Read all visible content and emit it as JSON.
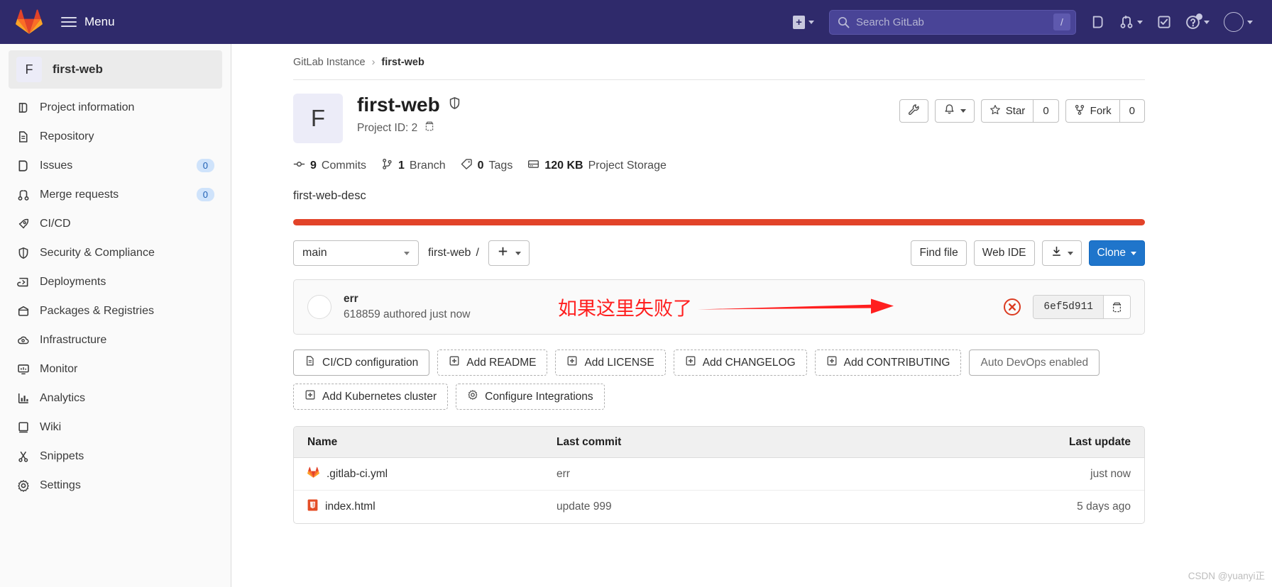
{
  "topnav": {
    "brand_icon": "gitlab-logo-icon",
    "menu_label": "Menu",
    "create_icon": "plus-square-icon",
    "search_placeholder": "Search GitLab",
    "search_value": "",
    "search_shortcut": "/",
    "issues_icon": "issues-icon",
    "merge_requests_icon": "merge-request-icon",
    "todos_icon": "todo-checkbox-icon",
    "help_icon": "question-circle-icon",
    "avatar_icon": "user-avatar-icon"
  },
  "sidebar": {
    "project_initial": "F",
    "project_name": "first-web",
    "items": [
      {
        "label": "Project information",
        "icon": "project-info-icon",
        "badge": ""
      },
      {
        "label": "Repository",
        "icon": "repository-doc-icon",
        "badge": ""
      },
      {
        "label": "Issues",
        "icon": "issues-icon",
        "badge": "0"
      },
      {
        "label": "Merge requests",
        "icon": "merge-request-icon",
        "badge": "0"
      },
      {
        "label": "CI/CD",
        "icon": "rocket-icon",
        "badge": ""
      },
      {
        "label": "Security & Compliance",
        "icon": "shield-icon",
        "badge": ""
      },
      {
        "label": "Deployments",
        "icon": "deployments-icon",
        "badge": ""
      },
      {
        "label": "Packages & Registries",
        "icon": "package-icon",
        "badge": ""
      },
      {
        "label": "Infrastructure",
        "icon": "cloud-gear-icon",
        "badge": ""
      },
      {
        "label": "Monitor",
        "icon": "monitor-icon",
        "badge": ""
      },
      {
        "label": "Analytics",
        "icon": "chart-bar-icon",
        "badge": ""
      },
      {
        "label": "Wiki",
        "icon": "book-icon",
        "badge": ""
      },
      {
        "label": "Snippets",
        "icon": "scissors-icon",
        "badge": ""
      },
      {
        "label": "Settings",
        "icon": "gear-icon",
        "badge": ""
      }
    ]
  },
  "breadcrumb": {
    "root": "GitLab Instance",
    "separator": "›",
    "current": "first-web"
  },
  "project": {
    "initial": "F",
    "title": "first-web",
    "visibility_icon": "shield-private-icon",
    "project_id_label": "Project ID: 2",
    "copy_icon": "copy-clipboard-icon",
    "description": "first-web-desc",
    "language_bar_color": "#e24329",
    "actions": {
      "settings_icon": "wrench-icon",
      "notifications_icon": "bell-icon",
      "star_label": "Star",
      "star_count": "0",
      "star_icon": "star-icon",
      "fork_label": "Fork",
      "fork_count": "0",
      "fork_icon": "fork-icon"
    },
    "stats": [
      {
        "icon": "commit-icon",
        "value": "9",
        "label": "Commits"
      },
      {
        "icon": "branch-icon",
        "value": "1",
        "label": "Branch"
      },
      {
        "icon": "tag-icon",
        "value": "0",
        "label": "Tags"
      },
      {
        "icon": "storage-icon",
        "value": "120 KB",
        "label": "Project Storage"
      }
    ]
  },
  "toolbar": {
    "branch": "main",
    "path_root": "first-web",
    "path_separator": "/",
    "add_icon": "plus-icon",
    "find_file_label": "Find file",
    "web_ide_label": "Web IDE",
    "download_icon": "download-icon",
    "clone_label": "Clone"
  },
  "last_commit": {
    "message": "err",
    "author_line": "618859 authored just now",
    "pipeline_status_icon": "pipeline-failed-icon",
    "sha": "6ef5d911",
    "copy_icon": "copy-clipboard-icon"
  },
  "annotation": {
    "text": "如果这里失败了",
    "color": "#ff1f1f",
    "arrow_icon": "red-arrow-right-icon"
  },
  "quick_actions": [
    {
      "label": "CI/CD configuration",
      "icon": "file-doc-icon",
      "style": "solid"
    },
    {
      "label": "Add README",
      "icon": "plus-box-icon",
      "style": "dashed"
    },
    {
      "label": "Add LICENSE",
      "icon": "plus-box-icon",
      "style": "dashed"
    },
    {
      "label": "Add CHANGELOG",
      "icon": "plus-box-icon",
      "style": "dashed"
    },
    {
      "label": "Add CONTRIBUTING",
      "icon": "plus-box-icon",
      "style": "dashed"
    },
    {
      "label": "Auto DevOps enabled",
      "icon": "",
      "style": "muted"
    },
    {
      "label": "Add Kubernetes cluster",
      "icon": "plus-box-icon",
      "style": "dashed"
    },
    {
      "label": "Configure Integrations",
      "icon": "gear-icon",
      "style": "dashed"
    }
  ],
  "file_table": {
    "columns": {
      "name": "Name",
      "last_commit": "Last commit",
      "last_update": "Last update"
    },
    "rows": [
      {
        "name": ".gitlab-ci.yml",
        "icon": "gitlab-file-icon",
        "last_commit": "err",
        "last_update": "just now"
      },
      {
        "name": "index.html",
        "icon": "html5-file-icon",
        "last_commit": "update 999",
        "last_update": "5 days ago"
      }
    ]
  },
  "watermark": "CSDN @yuanyi正"
}
